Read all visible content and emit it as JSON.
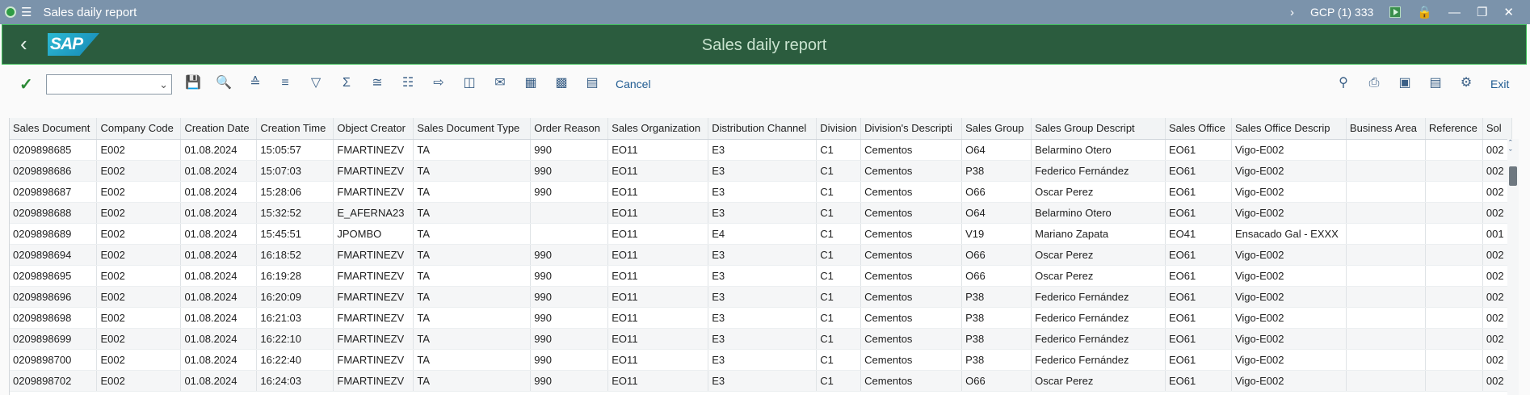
{
  "window": {
    "title": "Sales daily report",
    "system": "GCP (1) 333",
    "icons": [
      "app-icon",
      "menu-icon",
      "chevron-right-icon",
      "play-icon",
      "lock-icon",
      "minimize-icon",
      "restore-icon",
      "close-icon"
    ]
  },
  "header": {
    "logo_text": "SAP",
    "title": "Sales daily report",
    "back_icon": "back-icon",
    "colors": {
      "bar": "#2b5c3e",
      "border": "#3fc05a",
      "title": "#c9e3cf"
    }
  },
  "toolbar": {
    "layout_value": "",
    "cancel_label": "Cancel",
    "exit_label": "Exit",
    "left_tools": [
      "save",
      "details",
      "sort-ascending",
      "sort-descending",
      "filter",
      "total",
      "subtotal",
      "print-preview",
      "export",
      "local-file",
      "mail",
      "layout",
      "select-layout",
      "manage-layout"
    ],
    "right_tools": [
      "find",
      "print",
      "new-window",
      "layout-display",
      "settings"
    ]
  },
  "table": {
    "columns": [
      "Sales Document",
      "Company Code",
      "Creation Date",
      "Creation Time",
      "Object Creator",
      "Sales Document Type",
      "Order Reason",
      "Sales Organization",
      "Distribution Channel",
      "Division",
      "Division's Descripti",
      "Sales Group",
      "Sales Group Descript",
      "Sales Office",
      "Sales Office Descrip",
      "Business Area",
      "Reference",
      "Sol"
    ],
    "rows": [
      [
        "0209898685",
        "E002",
        "01.08.2024",
        "15:05:57",
        "FMARTINEZV",
        "TA",
        "990",
        "EO11",
        "E3",
        "C1",
        "Cementos",
        "O64",
        "Belarmino Otero",
        "EO61",
        "Vigo-E002",
        "",
        "",
        "002"
      ],
      [
        "0209898686",
        "E002",
        "01.08.2024",
        "15:07:03",
        "FMARTINEZV",
        "TA",
        "990",
        "EO11",
        "E3",
        "C1",
        "Cementos",
        "P38",
        "Federico Fernández",
        "EO61",
        "Vigo-E002",
        "",
        "",
        "002"
      ],
      [
        "0209898687",
        "E002",
        "01.08.2024",
        "15:28:06",
        "FMARTINEZV",
        "TA",
        "990",
        "EO11",
        "E3",
        "C1",
        "Cementos",
        "O66",
        "Oscar Perez",
        "EO61",
        "Vigo-E002",
        "",
        "",
        "002"
      ],
      [
        "0209898688",
        "E002",
        "01.08.2024",
        "15:32:52",
        "E_AFERNA23",
        "TA",
        "",
        "EO11",
        "E3",
        "C1",
        "Cementos",
        "O64",
        "Belarmino Otero",
        "EO61",
        "Vigo-E002",
        "",
        "",
        "002"
      ],
      [
        "0209898689",
        "E002",
        "01.08.2024",
        "15:45:51",
        "JPOMBO",
        "TA",
        "",
        "EO11",
        "E4",
        "C1",
        "Cementos",
        "V19",
        "Mariano Zapata",
        "EO41",
        "Ensacado Gal - EXXX",
        "",
        "",
        "001"
      ],
      [
        "0209898694",
        "E002",
        "01.08.2024",
        "16:18:52",
        "FMARTINEZV",
        "TA",
        "990",
        "EO11",
        "E3",
        "C1",
        "Cementos",
        "O66",
        "Oscar Perez",
        "EO61",
        "Vigo-E002",
        "",
        "",
        "002"
      ],
      [
        "0209898695",
        "E002",
        "01.08.2024",
        "16:19:28",
        "FMARTINEZV",
        "TA",
        "990",
        "EO11",
        "E3",
        "C1",
        "Cementos",
        "O66",
        "Oscar Perez",
        "EO61",
        "Vigo-E002",
        "",
        "",
        "002"
      ],
      [
        "0209898696",
        "E002",
        "01.08.2024",
        "16:20:09",
        "FMARTINEZV",
        "TA",
        "990",
        "EO11",
        "E3",
        "C1",
        "Cementos",
        "P38",
        "Federico Fernández",
        "EO61",
        "Vigo-E002",
        "",
        "",
        "002"
      ],
      [
        "0209898698",
        "E002",
        "01.08.2024",
        "16:21:03",
        "FMARTINEZV",
        "TA",
        "990",
        "EO11",
        "E3",
        "C1",
        "Cementos",
        "P38",
        "Federico Fernández",
        "EO61",
        "Vigo-E002",
        "",
        "",
        "002"
      ],
      [
        "0209898699",
        "E002",
        "01.08.2024",
        "16:22:10",
        "FMARTINEZV",
        "TA",
        "990",
        "EO11",
        "E3",
        "C1",
        "Cementos",
        "P38",
        "Federico Fernández",
        "EO61",
        "Vigo-E002",
        "",
        "",
        "002"
      ],
      [
        "0209898700",
        "E002",
        "01.08.2024",
        "16:22:40",
        "FMARTINEZV",
        "TA",
        "990",
        "EO11",
        "E3",
        "C1",
        "Cementos",
        "P38",
        "Federico Fernández",
        "EO61",
        "Vigo-E002",
        "",
        "",
        "002"
      ],
      [
        "0209898702",
        "E002",
        "01.08.2024",
        "16:24:03",
        "FMARTINEZV",
        "TA",
        "990",
        "EO11",
        "E3",
        "C1",
        "Cementos",
        "O66",
        "Oscar Perez",
        "EO61",
        "Vigo-E002",
        "",
        "",
        "002"
      ]
    ]
  }
}
